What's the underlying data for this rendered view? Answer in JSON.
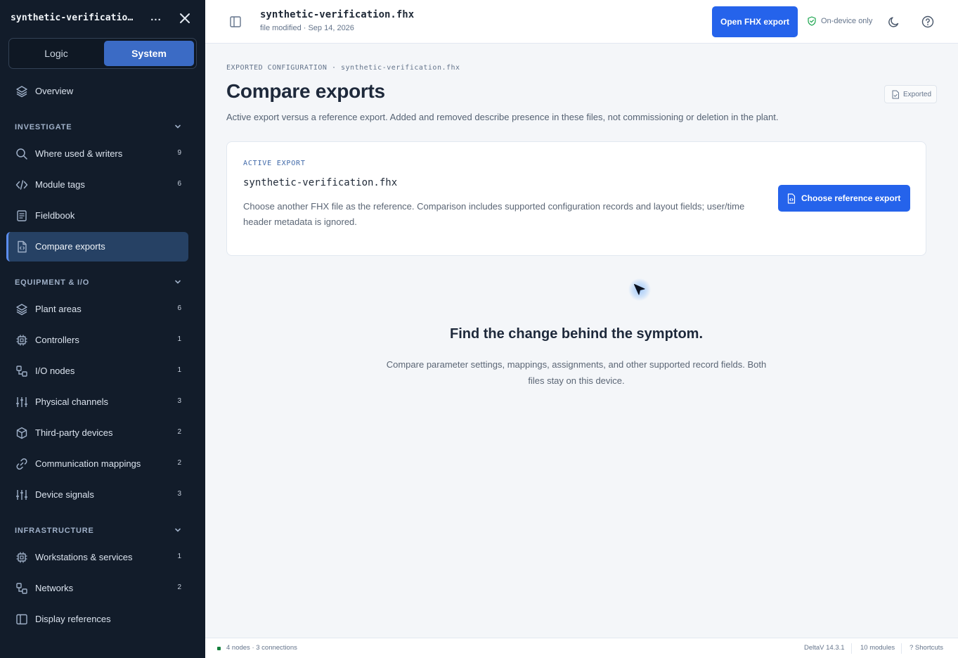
{
  "sidebar": {
    "title": "synthetic-verification.fhx",
    "more_label": "...",
    "segment": {
      "logic": "Logic",
      "system": "System",
      "selected": "System"
    },
    "overview": {
      "label": "Overview",
      "icon": "layers-icon"
    },
    "sections": [
      {
        "title": "INVESTIGATE",
        "items": [
          {
            "label": "Where used & writers",
            "count": "9",
            "icon": "search-icon"
          },
          {
            "label": "Module tags",
            "count": "6",
            "icon": "code-icon"
          },
          {
            "label": "Fieldbook",
            "count": "",
            "icon": "notebook-icon"
          },
          {
            "label": "Compare exports",
            "count": "",
            "icon": "file-code-icon",
            "active": true
          }
        ]
      },
      {
        "title": "EQUIPMENT & I/O",
        "items": [
          {
            "label": "Plant areas",
            "count": "6",
            "icon": "layers-icon"
          },
          {
            "label": "Controllers",
            "count": "1",
            "icon": "cpu-icon"
          },
          {
            "label": "I/O nodes",
            "count": "1",
            "icon": "nodes-icon"
          },
          {
            "label": "Physical channels",
            "count": "3",
            "icon": "sliders-icon"
          },
          {
            "label": "Third-party devices",
            "count": "2",
            "icon": "box-icon"
          },
          {
            "label": "Communication mappings",
            "count": "2",
            "icon": "link-icon"
          },
          {
            "label": "Device signals",
            "count": "3",
            "icon": "sliders-icon"
          }
        ]
      },
      {
        "title": "INFRASTRUCTURE",
        "items": [
          {
            "label": "Workstations & services",
            "count": "1",
            "icon": "cpu-icon"
          },
          {
            "label": "Networks",
            "count": "2",
            "icon": "nodes-icon"
          },
          {
            "label": "Display references",
            "count": "",
            "icon": "panel-icon"
          }
        ]
      }
    ]
  },
  "topbar": {
    "file_name": "synthetic-verification.fhx",
    "meta": "file modified · Sep 14, 2026",
    "open_button": "Open FHX export",
    "on_device": "On-device only"
  },
  "main": {
    "eyebrow": "EXPORTED CONFIGURATION · synthetic-verification.fhx",
    "title": "Compare exports",
    "badge": "Exported",
    "subtitle": "Active export versus a reference export. Added and removed describe presence in these files, not commissioning or deletion in the plant.",
    "card": {
      "label": "ACTIVE EXPORT",
      "file": "synthetic-verification.fhx",
      "description": "Choose another FHX file as the reference. Comparison includes supported configuration records and layout fields; user/time header metadata is ignored.",
      "button": "Choose reference export"
    },
    "empty": {
      "title": "Find the change behind the symptom.",
      "description": "Compare parameter settings, mappings, assignments, and other supported record fields. Both files stay on this device."
    }
  },
  "statusbar": {
    "left": "4 nodes · 3 connections",
    "version": "DeltaV 14.3.1",
    "modules": "10 modules",
    "shortcuts": "? Shortcuts"
  },
  "colors": {
    "sidebar_bg": "#121c2a",
    "accent": "#2563eb",
    "active_item": "#264164",
    "segment_selected": "#3b6bc5"
  }
}
